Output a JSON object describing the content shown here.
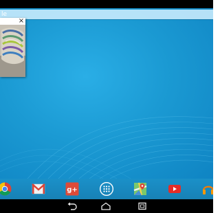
{
  "screen": {
    "wallpaper_color": "#1f9fd8",
    "status_bar_color": "#000000",
    "nav_bar_color": "#000000"
  },
  "search_bar": {
    "text": "le"
  },
  "pip_window": {
    "close_label": "×"
  },
  "dock": {
    "apps": [
      {
        "name": "chrome-icon"
      },
      {
        "name": "gmail-icon"
      },
      {
        "name": "google-plus-icon",
        "label": "g+"
      },
      {
        "name": "app-drawer-icon"
      },
      {
        "name": "maps-icon"
      },
      {
        "name": "youtube-icon"
      },
      {
        "name": "play-music-icon"
      }
    ]
  },
  "nav_bar": {
    "buttons": [
      "back-icon",
      "home-icon",
      "recents-icon"
    ]
  }
}
